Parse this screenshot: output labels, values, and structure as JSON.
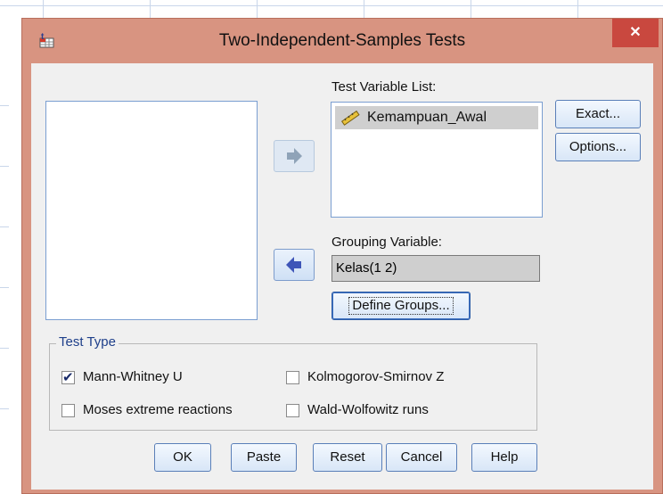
{
  "dialog": {
    "title": "Two-Independent-Samples Tests",
    "close_symbol": "✕",
    "app_icon": "spss-dialog-icon"
  },
  "source_list": {
    "items": []
  },
  "test_variable_list": {
    "label": "Test Variable List:",
    "items": [
      {
        "label": "Kemampuan_Awal",
        "icon": "ruler-icon"
      }
    ]
  },
  "grouping_variable": {
    "label": "Grouping Variable:",
    "value": "Kelas(1 2)"
  },
  "buttons": {
    "exact": "Exact...",
    "options": "Options...",
    "define_groups": "Define Groups...",
    "ok": "OK",
    "paste": "Paste",
    "reset": "Reset",
    "cancel": "Cancel",
    "help": "Help"
  },
  "test_type": {
    "title": "Test Type",
    "options": [
      {
        "label": "Mann-Whitney U",
        "checked": true
      },
      {
        "label": "Kolmogorov-Smirnov Z",
        "checked": false
      },
      {
        "label": "Moses extreme reactions",
        "checked": false
      },
      {
        "label": "Wald-Wolfowitz runs",
        "checked": false
      }
    ]
  }
}
